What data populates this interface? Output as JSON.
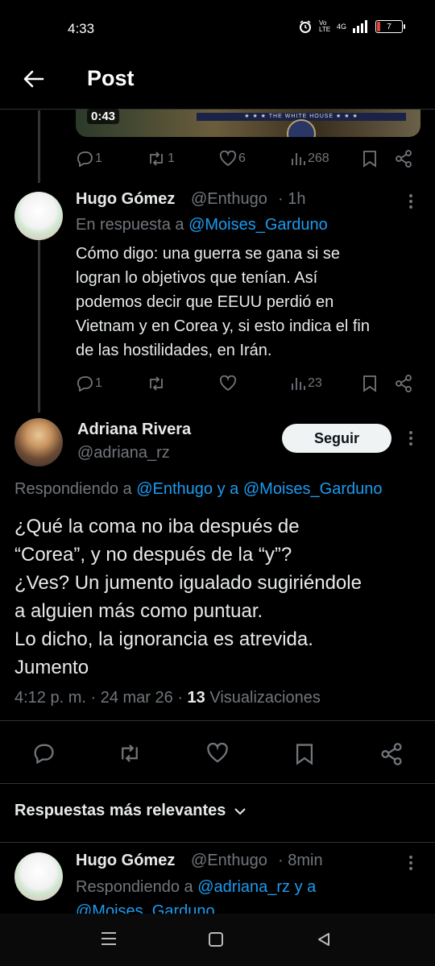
{
  "status_bar": {
    "time": "4:33",
    "network_label": "Vo LTE",
    "signal_label": "4G",
    "battery_level": "7"
  },
  "header": {
    "title": "Post",
    "back_icon": "arrow-left-icon"
  },
  "parent_video": {
    "duration": "0:43",
    "banner_text": "★ ★ ★ THE WHITE HOUSE ★ ★ ★"
  },
  "parent_actions": {
    "replies": "1",
    "reposts": "1",
    "likes": "6",
    "views": "268"
  },
  "reply_tweet": {
    "name": "Hugo Gómez",
    "handle": "@Enthugo",
    "time": "· 1h",
    "reply_prefix": "En respuesta a ",
    "reply_to": "@Moises_Garduno",
    "lines": [
      "Cómo digo: una guerra se gana si se",
      "logran lo objetivos que tenían. Así",
      "podemos decir que EEUU perdió en",
      "Vietnam y en Corea y, si esto indica el fin",
      "de las hostilidades, en Irán."
    ],
    "replies": "1",
    "views": "23"
  },
  "main_tweet": {
    "name": "Adriana Rivera",
    "handle": "@adriana_rz",
    "follow_label": "Seguir",
    "reply_prefix": "Respondiendo a ",
    "reply_to_1": "@Enthugo",
    "reply_conj": " y a ",
    "reply_to_2": "@Moises_Garduno",
    "lines": [
      "¿Qué la coma no iba después de",
      "“Corea”, y no después de la “y”?",
      "¿Ves? Un jumento igualado sugiriéndole",
      "a alguien más como puntuar.",
      "Lo dicho, la ignorancia es atrevida.",
      "Jumento"
    ],
    "meta_time": "4:12 p. m. · 24 mar 26 · ",
    "views_count": "13",
    "views_label": " Visualizaciones"
  },
  "sort": {
    "label": "Respuestas más relevantes"
  },
  "bottom_reply": {
    "name": "Hugo Gómez",
    "handle": "@Enthugo",
    "time": "· 8min",
    "reply_prefix": "Respondiendo a ",
    "reply_to_1": "@adriana_rz",
    "reply_conj": " y a",
    "reply_to_2": "@Moises_Garduno"
  },
  "colors": {
    "background": "#000000",
    "link": "#1d9bf0",
    "muted": "#71767b",
    "text": "#e7e9ea"
  }
}
